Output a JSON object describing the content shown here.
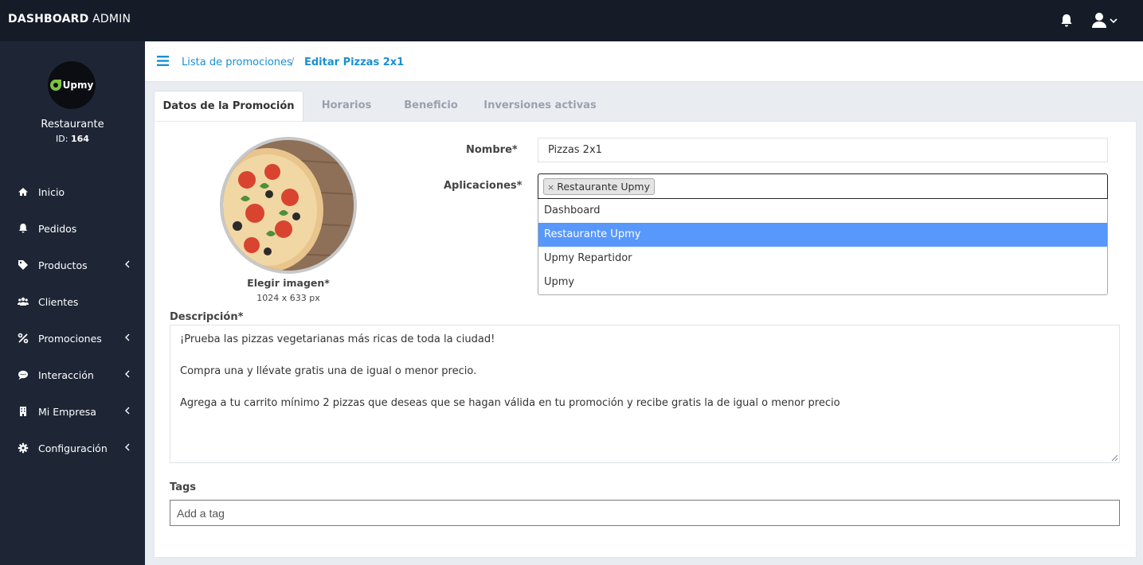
{
  "topbar": {
    "brand_bold": "DASHBOARD",
    "brand_rest": " ADMIN",
    "icons": [
      "bell-icon",
      "user-icon",
      "chevron-down-icon"
    ]
  },
  "sidebar": {
    "logo_text": "Upmy",
    "restaurant_name": "Restaurante",
    "id_label": "ID: ",
    "id_value": "164",
    "items": [
      {
        "label": "Inicio",
        "icon": "home-icon",
        "has_chevron": false
      },
      {
        "label": "Pedidos",
        "icon": "bell-icon",
        "has_chevron": false
      },
      {
        "label": "Productos",
        "icon": "tag-icon",
        "has_chevron": true
      },
      {
        "label": "Clientes",
        "icon": "users-icon",
        "has_chevron": false
      },
      {
        "label": "Promociones",
        "icon": "percent-icon",
        "has_chevron": true
      },
      {
        "label": "Interacción",
        "icon": "chat-icon",
        "has_chevron": true
      },
      {
        "label": "Mi Empresa",
        "icon": "building-icon",
        "has_chevron": true
      },
      {
        "label": "Configuración",
        "icon": "gear-icon",
        "has_chevron": true
      }
    ]
  },
  "breadcrumb": {
    "parent": "Lista de promociones",
    "separator": "/",
    "current": "Editar Pizzas 2x1"
  },
  "tabs": [
    {
      "label": "Datos de la Promoción",
      "active": true
    },
    {
      "label": "Horarios",
      "active": false
    },
    {
      "label": "Beneficio",
      "active": false
    },
    {
      "label": "Inversiones activas",
      "active": false
    }
  ],
  "form": {
    "image_label": "Elegir imagen*",
    "image_size": "1024 x 633 px",
    "nombre_label": "Nombre*",
    "nombre_value": "Pizzas 2x1",
    "aplicaciones_label": "Aplicaciones*",
    "selected_chip": "Restaurante Upmy",
    "chip_remove": "×",
    "options": [
      "Dashboard",
      "Restaurante Upmy",
      "Upmy Repartidor",
      "Upmy"
    ],
    "highlighted_option": "Restaurante Upmy",
    "descripcion_label": "Descripción*",
    "descripcion_lines": [
      "¡Prueba las pizzas vegetarianas más ricas de toda la ciudad!",
      "",
      "Compra una y llévate gratis una de igual o menor precio.",
      "",
      "Agrega a tu carrito mínimo 2 pizzas que deseas que se hagan válida en tu promoción y recibe gratis la de igual o menor precio"
    ],
    "tags_label": "Tags",
    "tags_placeholder": "Add a tag"
  },
  "colors": {
    "topbar": "#151c28",
    "sidebar": "#1e2636",
    "link": "#1a8fd1",
    "highlight": "#5897fb",
    "logo_green": "#7cc242"
  }
}
